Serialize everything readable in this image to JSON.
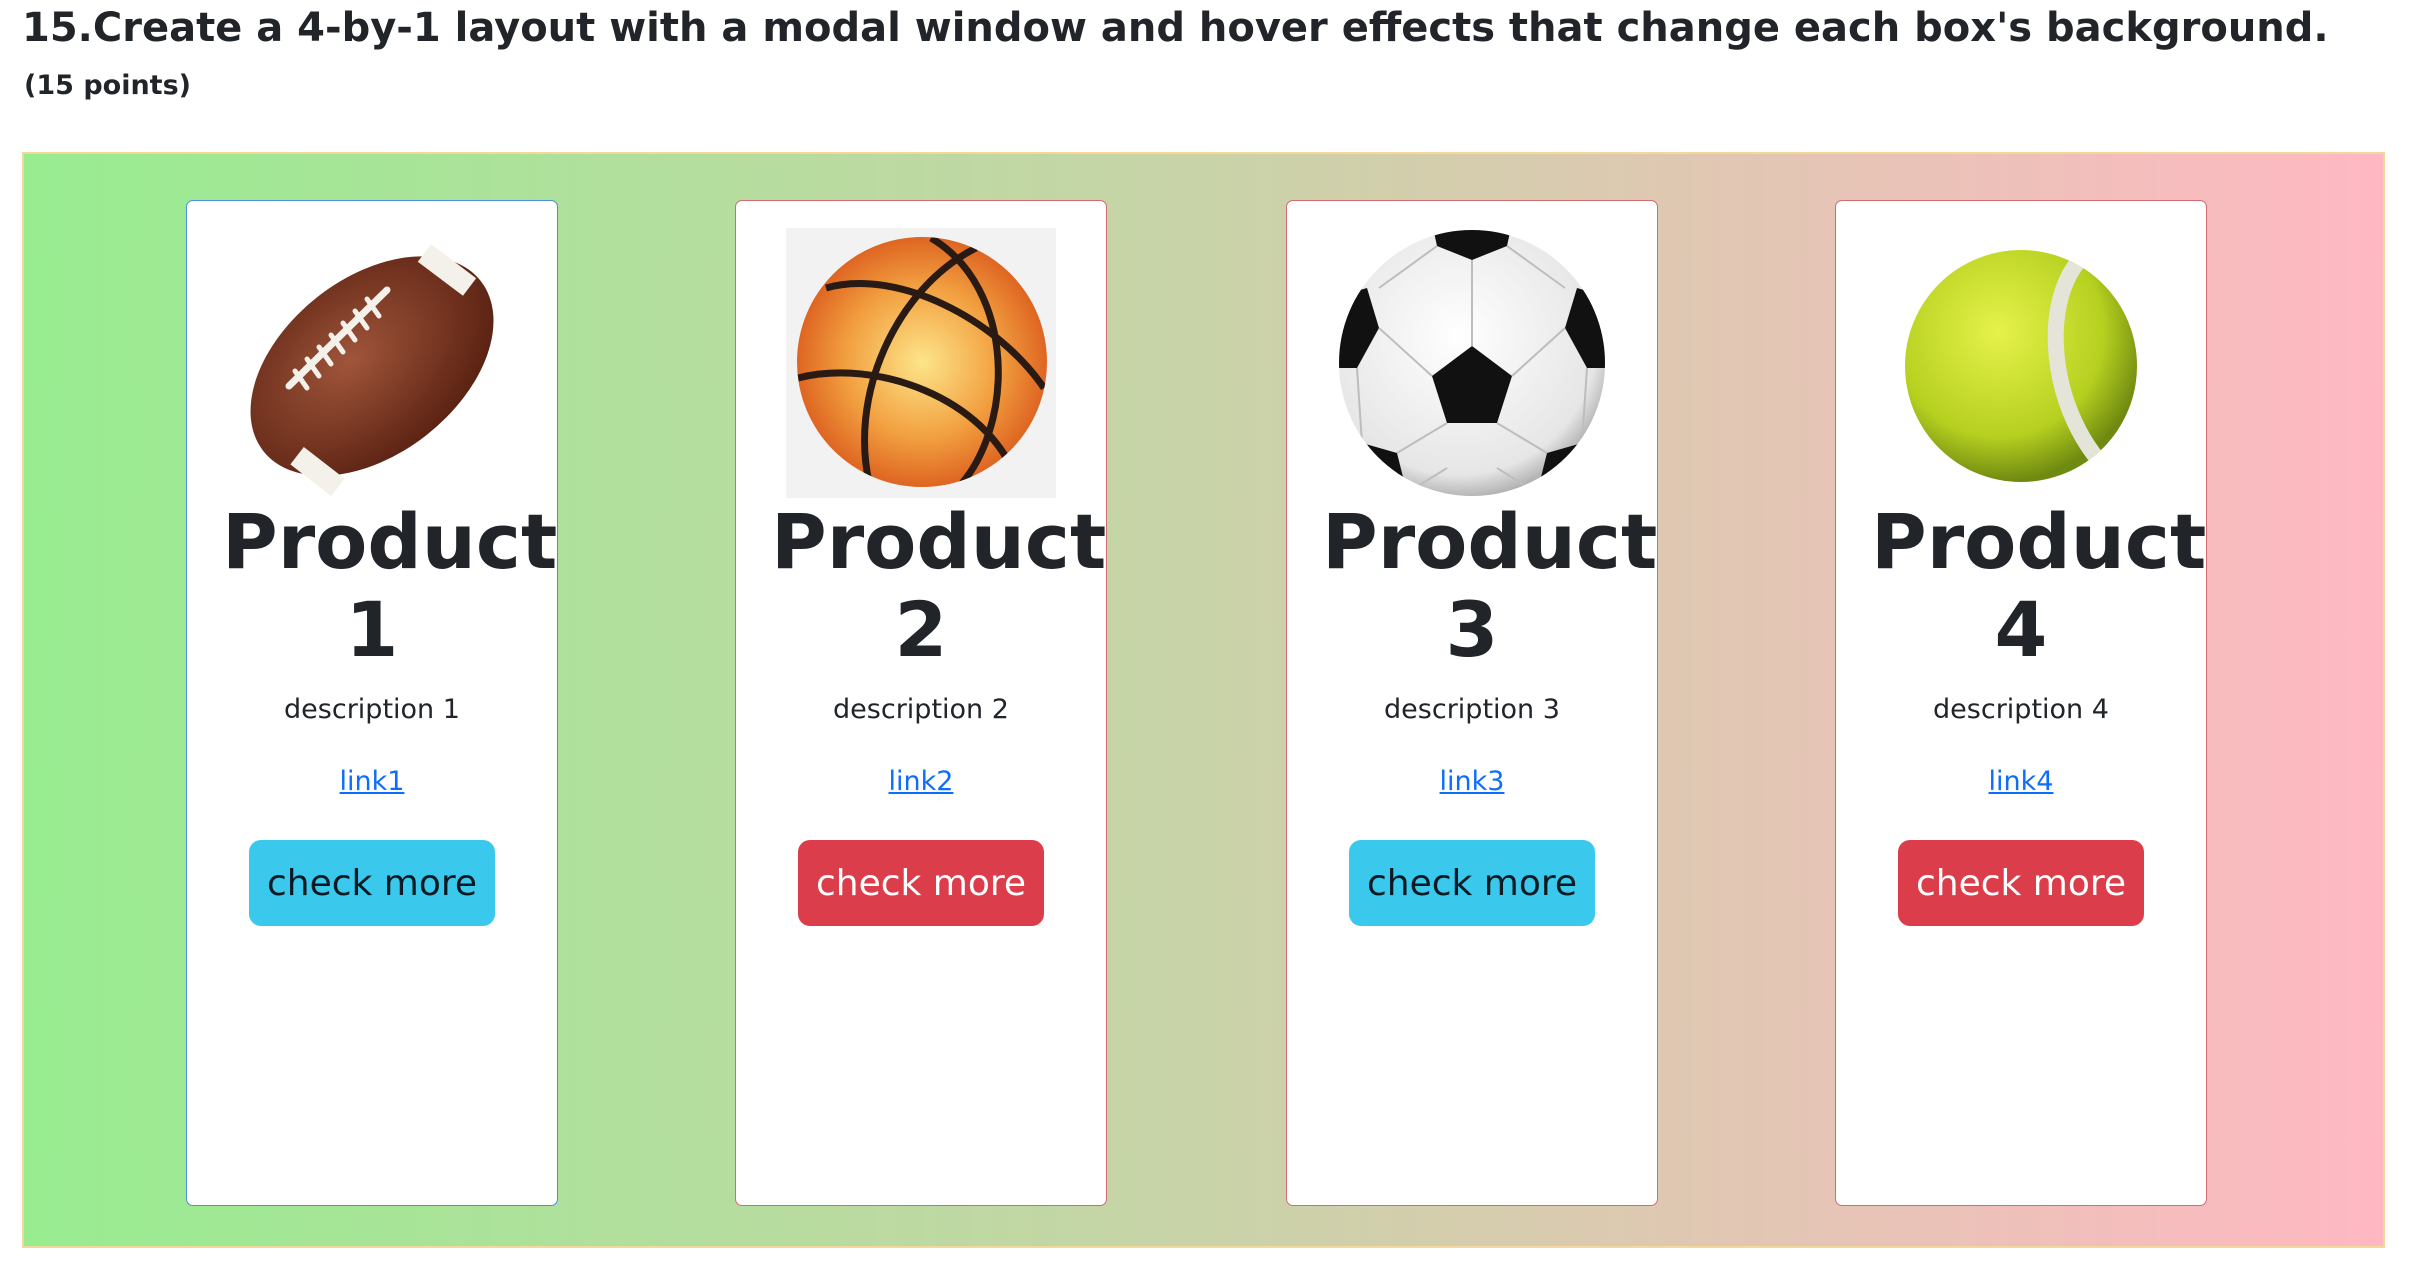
{
  "question": {
    "title": "15.Create a 4-by-1 layout with a modal window and hover effects that change each box's background.",
    "points": "(15 points)"
  },
  "products": [
    {
      "name_line1": "Product",
      "name_line2": "1",
      "description": "description 1",
      "link": "link1",
      "button": "check more",
      "button_color": "#3ac8ec",
      "image": "american-football-icon"
    },
    {
      "name_line1": "Product",
      "name_line2": "2",
      "description": "description 2",
      "link": "link2",
      "button": "check more",
      "button_color": "#dc3d4b",
      "image": "basketball-icon"
    },
    {
      "name_line1": "Product",
      "name_line2": "3",
      "description": "description 3",
      "link": "link3",
      "button": "check more",
      "button_color": "#3ac8ec",
      "image": "soccer-ball-icon"
    },
    {
      "name_line1": "Product",
      "name_line2": "4",
      "description": "description 4",
      "link": "link4",
      "button": "check more",
      "button_color": "#dc3d4b",
      "image": "tennis-ball-icon"
    }
  ],
  "colors": {
    "gradient_start": "#98ec90",
    "gradient_end": "#ffb8c2",
    "info": "#3ac8ec",
    "danger": "#dc3d4b",
    "link": "#0d6efd"
  }
}
